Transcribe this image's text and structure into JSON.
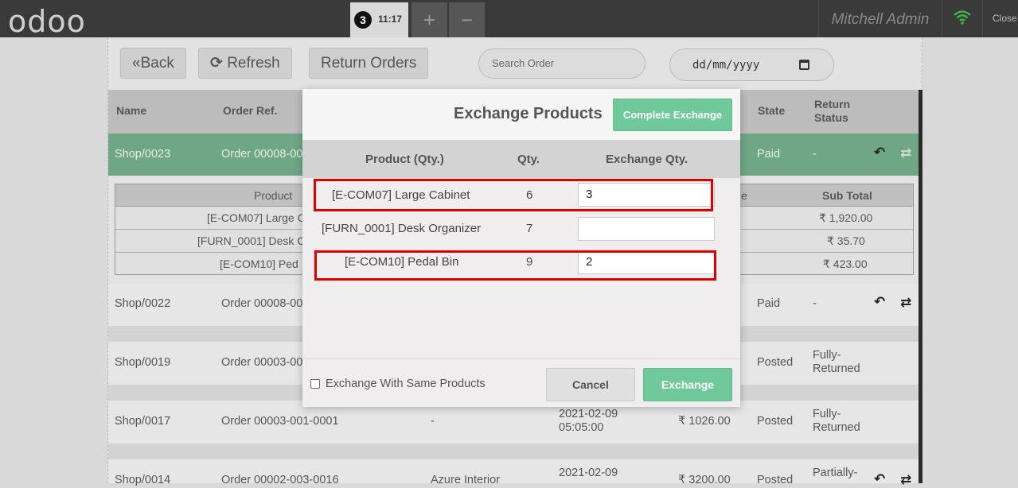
{
  "topbar": {
    "logo": "odoo",
    "order_count": "3",
    "order_time": "11:17",
    "plus": "+",
    "minus": "−",
    "user": "Mitchell Admin",
    "close": "Close"
  },
  "controls": {
    "back": "Back",
    "refresh": "Refresh",
    "return_orders": "Return Orders",
    "search_placeholder": "Search Order",
    "date_placeholder": "dd/mm/yyyy"
  },
  "table": {
    "headers": {
      "name": "Name",
      "ref": "Order Ref.",
      "state": "State",
      "return_status": "Return\nStatus"
    },
    "rows": [
      {
        "name": "Shop/0023",
        "ref": "Order 00008-00",
        "state": "Paid",
        "return_status": "-"
      },
      {
        "name": "Shop/0022",
        "ref": "Order 00008-00",
        "state": "Paid",
        "return_status": "-"
      },
      {
        "name": "Shop/0019",
        "ref": "Order 00003-00",
        "state": "Posted",
        "return_status": "Fully-\nReturned"
      },
      {
        "name": "Shop/0017",
        "ref": "Order 00003-001-0001",
        "customer": "-",
        "date": "2021-02-09\n05:05:00",
        "total": "₹ 1026.00",
        "state": "Posted",
        "return_status": "Fully-\nReturned"
      },
      {
        "name": "Shop/0014",
        "ref": "Order 00002-003-0016",
        "customer": "Azure Interior",
        "date": "2021-02-09",
        "total": "₹ 3200.00",
        "state": "Posted",
        "return_status": "Partially-"
      }
    ]
  },
  "detail": {
    "headers": {
      "product": "Product",
      "partial": "e",
      "subtotal": "Sub Total"
    },
    "rows": [
      {
        "product": "[E-COM07] Large C",
        "subtotal": "₹ 1,920.00"
      },
      {
        "product": "[FURN_0001] Desk C",
        "subtotal": "₹ 35.70"
      },
      {
        "product": "[E-COM10] Ped",
        "subtotal": "₹ 423.00"
      }
    ]
  },
  "modal": {
    "title": "Exchange Products",
    "complete_button": "Complete Exchange",
    "headers": {
      "product": "Product (Qty.)",
      "qty": "Qty.",
      "exchange_qty": "Exchange Qty."
    },
    "rows": [
      {
        "product": "[E-COM07] Large Cabinet",
        "qty": "6",
        "exchange_qty": "3"
      },
      {
        "product": "[FURN_0001] Desk Organizer",
        "qty": "7",
        "exchange_qty": ""
      },
      {
        "product": "[E-COM10] Pedal Bin",
        "qty": "9",
        "exchange_qty": "2"
      }
    ],
    "same_products_label": "Exchange With Same Products",
    "cancel": "Cancel",
    "exchange": "Exchange"
  },
  "colors": {
    "accent_green": "#6fc99a",
    "selected_row": "#6fa686",
    "highlight_red": "#e00000",
    "topbar": "#3a3a3a"
  }
}
